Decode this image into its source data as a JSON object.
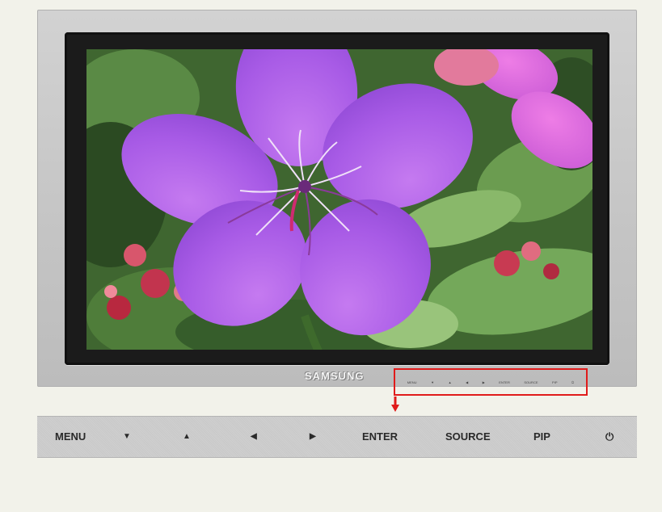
{
  "monitor": {
    "brand": "SAMSUNG",
    "mini_buttons": [
      "MENU",
      "▼",
      "▲",
      "◀",
      "▶",
      "ENTER",
      "SOURCE",
      "PIP",
      "⏻"
    ]
  },
  "control_panel": {
    "menu": "MENU",
    "down": "▼",
    "up": "▲",
    "left": "◀",
    "right": "▶",
    "enter": "ENTER",
    "source": "SOURCE",
    "pip": "PIP",
    "power": "⏻"
  },
  "icons": {
    "pointer": "down-arrow-icon",
    "power": "power-icon"
  },
  "colors": {
    "highlight": "#e01b1b",
    "bezel": "#1b1b1b",
    "panel": "#cbcbcb"
  }
}
